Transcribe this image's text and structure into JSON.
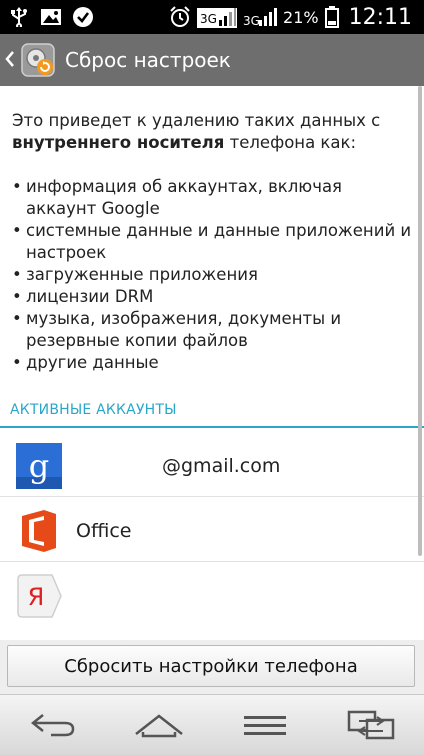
{
  "status_bar": {
    "battery_percent": "21%",
    "time": "12:11",
    "icons": [
      "usb-icon",
      "image-icon",
      "check-icon",
      "alarm-icon",
      "signal-1-icon",
      "signal-2-icon",
      "battery-icon"
    ]
  },
  "header": {
    "title": "Сброс настроек",
    "app_icon": "reset-icon"
  },
  "intro": {
    "text_before": "Это приведет к удалению таких данных с ",
    "text_bold": "внутреннего носителя",
    "text_after": " телефона как:"
  },
  "bullets": [
    "информация об аккаунтах, включая аккаунт Google",
    "системные данные и данные приложений и настроек",
    "загруженные приложения",
    "лицензии DRM",
    "музыка, изображения, документы и резервные копии файлов",
    "другие данные"
  ],
  "accounts_section": {
    "header": "АКТИВНЫЕ АККАУНТЫ",
    "items": [
      {
        "icon": "google-icon",
        "label": "@gmail.com"
      },
      {
        "icon": "office-icon",
        "label": "Office"
      },
      {
        "icon": "yandex-icon",
        "label": ""
      }
    ]
  },
  "reset_button": {
    "label": "Сбросить настройки телефона"
  },
  "nav": {
    "buttons": [
      "back-icon",
      "home-icon",
      "menu-icon",
      "dual-window-icon"
    ]
  },
  "colors": {
    "accent": "#2aa7c8",
    "titlebar": "#6e6e6e",
    "office": "#e64a19",
    "google": "#2b6fd6",
    "yandex": "#e02020"
  }
}
